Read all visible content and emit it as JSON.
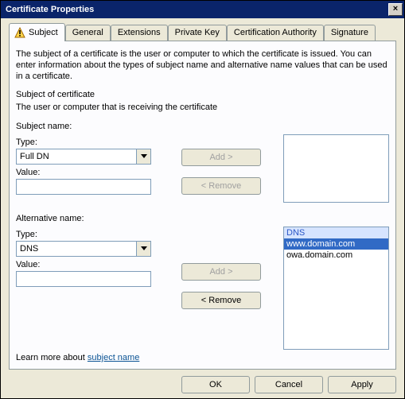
{
  "window": {
    "title": "Certificate Properties",
    "close": "×"
  },
  "tabs": {
    "subject": "Subject",
    "general": "General",
    "extensions": "Extensions",
    "private_key": "Private Key",
    "cert_auth": "Certification Authority",
    "signature": "Signature"
  },
  "desc": "The subject of a certificate is the user or computer to which the certificate is issued. You can enter information about the types of subject name and alternative name values that can be used in a certificate.",
  "subject_of_cert": "Subject of certificate",
  "subject_sub": "The user or computer that is receiving the certificate",
  "subject_name_heading": "Subject name:",
  "alt_name_heading": "Alternative name:",
  "labels": {
    "type": "Type:",
    "value": "Value:"
  },
  "subject_name": {
    "type_value": "Full DN",
    "value_value": ""
  },
  "alt_name": {
    "type_value": "DNS",
    "value_value": ""
  },
  "buttons": {
    "add": "Add >",
    "remove": "< Remove",
    "ok": "OK",
    "cancel": "Cancel",
    "apply": "Apply"
  },
  "alt_list": {
    "header": "DNS",
    "items": [
      "www.domain.com",
      "owa.domain.com"
    ],
    "selected_index": 0
  },
  "learn_more_prefix": "Learn more about ",
  "learn_more_link": "subject name"
}
